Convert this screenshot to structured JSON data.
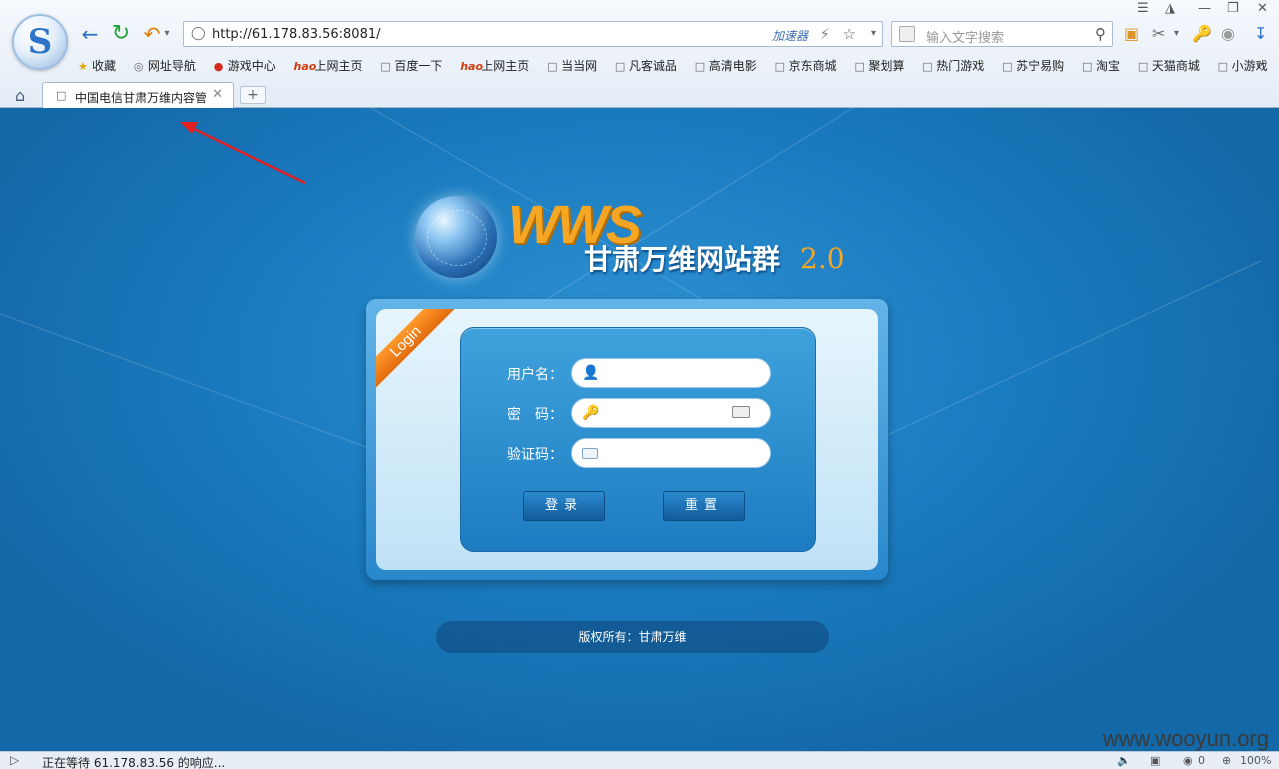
{
  "browser": {
    "url": "http://61.178.83.56:8081/",
    "accelerator_label": "加速器",
    "search_placeholder": "输入文字搜索",
    "bookmarks": [
      "收藏",
      "网址导航",
      "游戏中心",
      "上网主页",
      "百度一下",
      "上网主页",
      "当当网",
      "凡客诚品",
      "高清电影",
      "京东商城",
      "聚划算",
      "热门游戏",
      "苏宁易购",
      "淘宝",
      "天猫商城",
      "小游戏"
    ],
    "tab_title": "中国电信甘肃万维内容管",
    "new_tab_label": "+"
  },
  "page": {
    "logo_wws": "WWS",
    "brand_name": "甘肃万维网站群",
    "version": "2.0",
    "ribbon": "Login",
    "form": {
      "username_label": "用户名：",
      "password_label": "密　码：",
      "captcha_label": "验证码：",
      "username_value": "",
      "password_value": "",
      "captcha_value": "",
      "login_button": "登录",
      "reset_button": "重置"
    },
    "copyright": "版权所有：甘肃万维"
  },
  "statusbar": {
    "text": "正在等待 61.178.83.56 的响应...",
    "count": "0",
    "zoom": "100%"
  },
  "watermark": "www.wooyun.org",
  "colors": {
    "page_bg": "#1a7bbf",
    "accent_orange": "#f5a623",
    "arrow": "#e02020"
  }
}
